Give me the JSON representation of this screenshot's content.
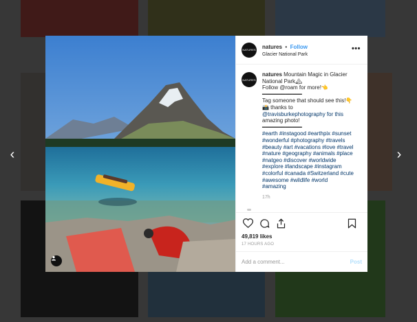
{
  "colors": {
    "accent": "#3897f0",
    "text": "#262626",
    "muted": "#999999",
    "overlay": "rgba(0,0,0,0.55)"
  },
  "nav": {
    "prev_icon": "chevron-left-icon",
    "next_icon": "chevron-right-icon",
    "prev_glyph": "‹",
    "next_glyph": "›"
  },
  "post": {
    "avatar_text": "NATURES",
    "username": "natures",
    "separator": "•",
    "follow_label": "Follow",
    "location": "Glacier National Park",
    "more_label": "•••",
    "caption": {
      "username": "natures",
      "lines": [
        "Mountain Magic in Glacier",
        "National Park🏔",
        "Follow @roam for more!👈",
        "━━━━━━━━━━━━",
        "Tag someone that should see this!👇",
        "📸 thanks to",
        "@travisburkephotography for this",
        "amazing photo!",
        "━━━━━━━━━━━━",
        "#earth #instagood #earthpix #sunset",
        "#wonderful #photography #travels",
        "#beauty #art #vacations #love #travel",
        "#nature #geography #animals #place",
        "#natgeo #discover #worldwide",
        "#explore #landscape #instagram",
        "#colorful #canada #Switzerland #cute",
        "#awesome #wildlife #world",
        "#amazing"
      ],
      "time_ago": "17h"
    },
    "likes": "49,819 likes",
    "posted": "17 HOURS AGO",
    "comment_placeholder": "Add a comment...",
    "post_label": "Post"
  }
}
